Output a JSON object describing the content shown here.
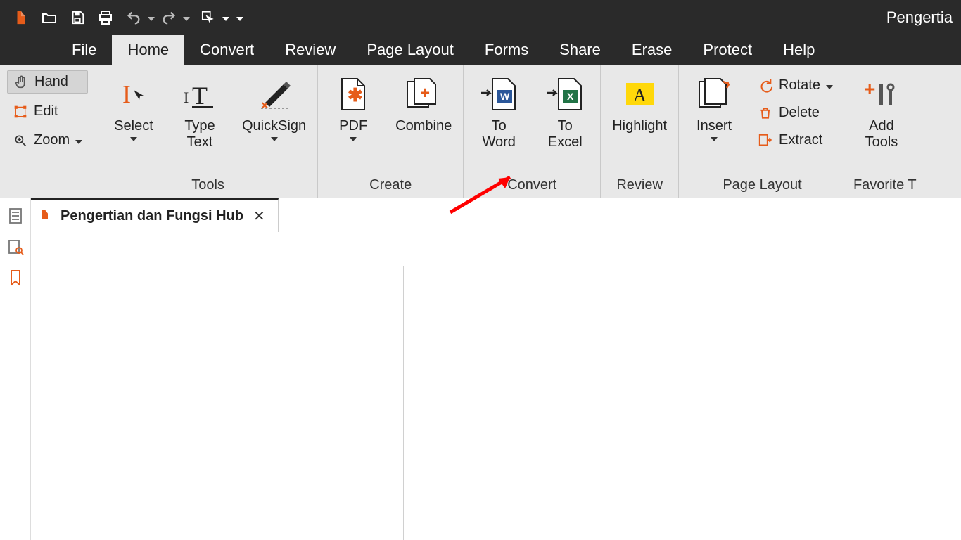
{
  "app_title": "Pengertia",
  "menu": {
    "file": "File",
    "home": "Home",
    "convert": "Convert",
    "review": "Review",
    "page_layout": "Page Layout",
    "forms": "Forms",
    "share": "Share",
    "erase": "Erase",
    "protect": "Protect",
    "help": "Help"
  },
  "ribbon": {
    "left": {
      "hand": "Hand",
      "edit": "Edit",
      "zoom": "Zoom"
    },
    "tools": {
      "label": "Tools",
      "select": "Select",
      "type_text": "Type\nText",
      "quicksign": "QuickSign"
    },
    "create": {
      "label": "Create",
      "pdf": "PDF",
      "combine": "Combine"
    },
    "convert": {
      "label": "Convert",
      "to_word": "To\nWord",
      "to_excel": "To\nExcel"
    },
    "review": {
      "label": "Review",
      "highlight": "Highlight"
    },
    "page_layout": {
      "label": "Page Layout",
      "insert": "Insert",
      "rotate": "Rotate",
      "delete": "Delete",
      "extract": "Extract"
    },
    "favorite": {
      "label": "Favorite T",
      "add_tools": "Add\nTools"
    }
  },
  "document_tab": {
    "title": "Pengertian dan Fungsi Hub"
  }
}
